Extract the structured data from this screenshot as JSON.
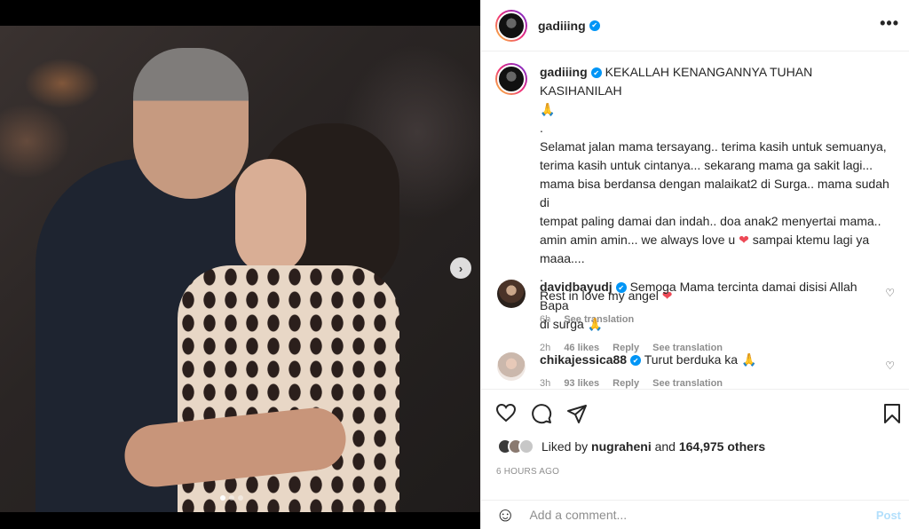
{
  "post": {
    "username": "gadiiing",
    "verified_mark": "✔",
    "more_icon": "•••"
  },
  "caption": {
    "username": "gadiiing",
    "first_line": "KEKALLAH KENANGANNYA TUHAN KASIHANILAH",
    "emoji_pray": "🙏",
    "dot1": ".",
    "line1": "Selamat jalan mama tersayang.. terima kasih untuk semuanya,",
    "line2": "terima kasih untuk cintanya... sekarang mama ga sakit lagi...",
    "line3": "mama bisa berdansa dengan malaikat2 di Surga.. mama sudah di",
    "line4": "tempat paling damai dan indah.. doa anak2 menyertai mama..",
    "line5a": "amin amin amin... we always love u",
    "heart": "❤",
    "line5b": "sampai ktemu lagi ya",
    "line6": "maaa....",
    "dot2": ".",
    "line7": "Rest in love my angel",
    "time": "6h",
    "see_translation": "See translation"
  },
  "comments": [
    {
      "username": "davidbayudj",
      "text_a": "Semoga Mama tercinta damai disisi Allah Bapa",
      "text_b": "di surga",
      "emoji": "🙏",
      "time": "2h",
      "likes": "46 likes",
      "reply": "Reply",
      "see_translation": "See translation"
    },
    {
      "username": "chikajessica88",
      "text": "Turut berduka ka",
      "emoji": "🙏",
      "time": "3h",
      "likes": "93 likes",
      "reply": "Reply",
      "see_translation": "See translation"
    }
  ],
  "icons": {
    "like": "♡",
    "comment": "◯",
    "share": "➤",
    "save": "⛉",
    "comment_heart": "♡",
    "emoji": "☺",
    "next": "›"
  },
  "likes": {
    "prefix": "Liked by",
    "user": "nugraheni",
    "and": "and",
    "count": "164,975 others"
  },
  "timestamp": "6 HOURS AGO",
  "add_comment": {
    "placeholder": "Add a comment...",
    "post_label": "Post"
  },
  "colors": {
    "verified": "#0095f6",
    "heart": "#ed4956",
    "post_disabled": "#b2dffc"
  },
  "carousel": {
    "slides": 3,
    "current": 1
  }
}
